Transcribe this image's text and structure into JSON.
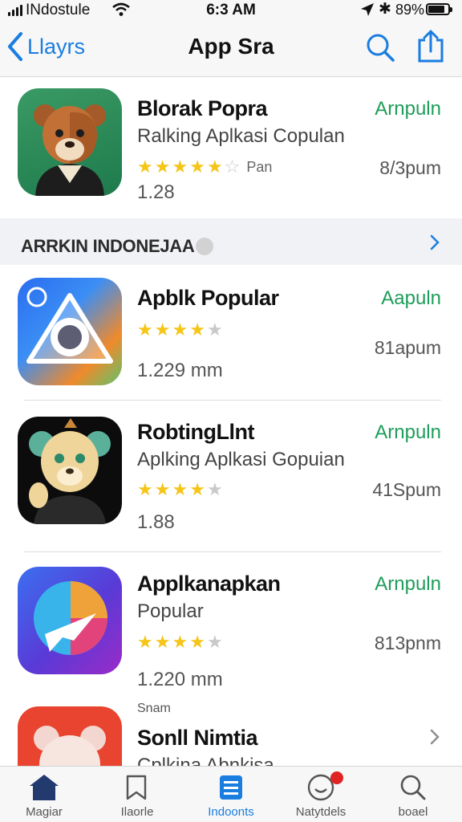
{
  "status_bar": {
    "carrier": "INdostule",
    "time": "6:3 AM",
    "battery": "89%"
  },
  "nav": {
    "back_label": "Llayrs",
    "title": "App Sra",
    "icons": [
      "chevron-left-icon",
      "search-icon",
      "share-icon"
    ]
  },
  "featured": {
    "name": "Blorak Popra",
    "subtitle": "Ralking Aplkasi Copulan",
    "rating_text": "Pan",
    "count": "1.28",
    "action": "Arnpuln",
    "price": "8/3pum",
    "stars": 4.5
  },
  "section": {
    "title": "ARRKIN INDONEJAA"
  },
  "apps": [
    {
      "name": "Apblk Popular",
      "subtitle": "",
      "count": "1.229 mm",
      "action": "Aapuln",
      "price": "81apum",
      "stars": 4
    },
    {
      "name": "RobtingLlnt",
      "subtitle": "Aplking Aplkasi Gopuian",
      "count": "1.88",
      "action": "Arnpuln",
      "price": "41Spum",
      "stars": 4
    },
    {
      "name": "Applkanapkan",
      "subtitle": "Popular",
      "count": "1.220 mm",
      "action": "Arnpuln",
      "price": "813pnm",
      "stars": 4
    },
    {
      "name": "Sonll Nimtia",
      "caption": "Snam",
      "subtitle": "Cplkina Abnkisa",
      "count": "",
      "action": "",
      "price": "",
      "stars": 0
    }
  ],
  "tabs": [
    {
      "label": "Magiar",
      "icon": "home-icon"
    },
    {
      "label": "Ilaorle",
      "icon": "star-icon"
    },
    {
      "label": "Indoonts",
      "icon": "list-icon"
    },
    {
      "label": "Natytdels",
      "icon": "notifications-icon"
    },
    {
      "label": "boael",
      "icon": "search-icon"
    }
  ],
  "colors": {
    "accent": "#1a7de0",
    "get_green": "#1f9d5a",
    "star": "#f5c518"
  }
}
